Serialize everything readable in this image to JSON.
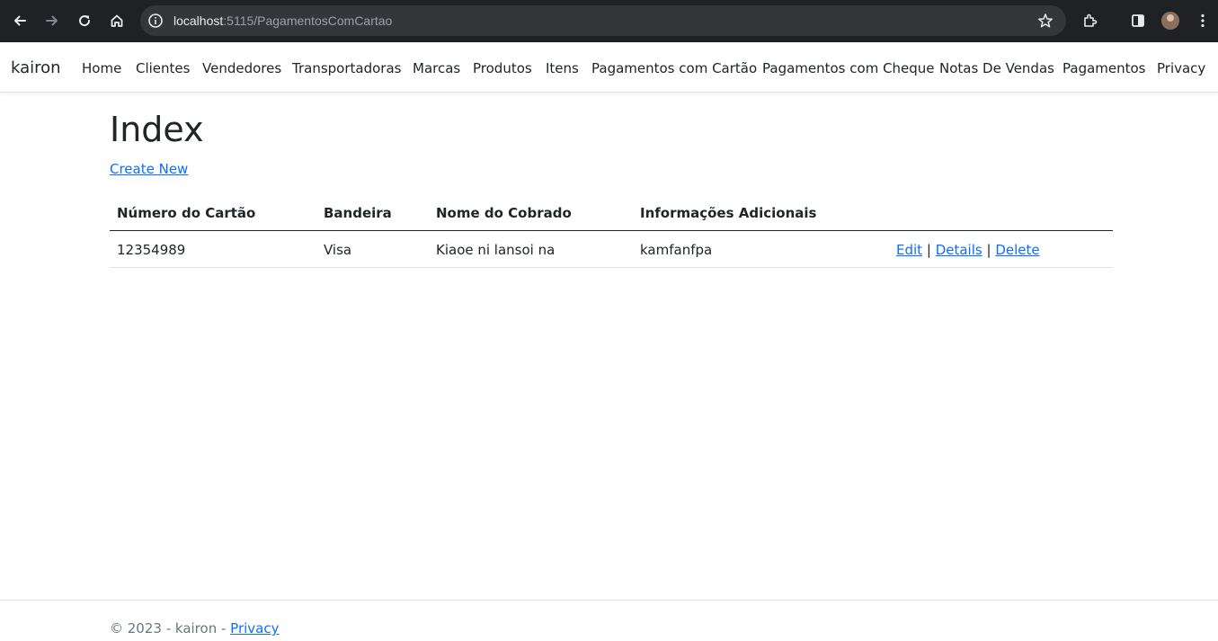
{
  "browser": {
    "url_host": "localhost",
    "url_path": ":5115/PagamentosComCartao",
    "icons": [
      "back-icon",
      "forward-icon",
      "reload-icon",
      "home-icon",
      "site-info-icon",
      "bookmark-star-icon",
      "extensions-icon",
      "side-panel-icon",
      "profile-avatar",
      "menu-kebab-icon"
    ]
  },
  "navbar": {
    "brand": "kairon",
    "links": [
      "Home",
      "Clientes",
      "Vendedores",
      "Transportadoras",
      "Marcas",
      "Produtos",
      "Itens",
      "Pagamentos com Cartão",
      "Pagamentos com Cheque",
      "Notas De Vendas",
      "Pagamentos",
      "Privacy"
    ]
  },
  "main": {
    "title": "Index",
    "create_label": "Create New"
  },
  "table": {
    "headers": [
      "Número do Cartão",
      "Bandeira",
      "Nome do Cobrado",
      "Informações Adicionais"
    ],
    "rows": [
      {
        "numero": "12354989",
        "bandeira": "Visa",
        "nome": "Kiaoe ni lansoi na",
        "info": "kamfanfpa",
        "edit": "Edit",
        "details": "Details",
        "delete": "Delete",
        "sep": "|"
      }
    ]
  },
  "footer": {
    "text": "© 2023 - kairon - ",
    "privacy": "Privacy"
  },
  "colors": {
    "chrome_bg": "#202124",
    "omnibox_bg": "#35363a",
    "link": "#0d6efd",
    "text": "#212529",
    "muted": "#6c757d"
  }
}
